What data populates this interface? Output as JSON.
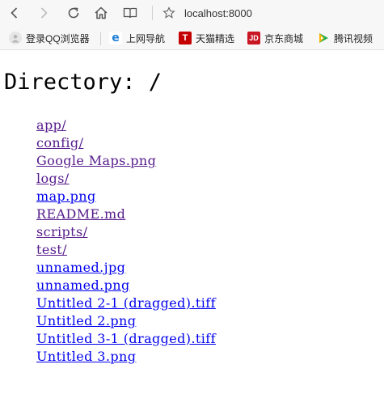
{
  "browser": {
    "address": "localhost:8000",
    "nav_icons": [
      "back-icon",
      "forward-icon",
      "reload-icon",
      "home-icon",
      "reader-icon",
      "bookmark-star-icon"
    ]
  },
  "bookmarks": [
    {
      "label": "登录QQ浏览器",
      "icon": "user-avatar-icon",
      "color": "#bdbdbd"
    },
    {
      "label": "上网导航",
      "icon": "ie-e-icon",
      "color": "#1e7fd6"
    },
    {
      "label": "天猫精选",
      "icon": "tmall-icon",
      "color": "#c40000"
    },
    {
      "label": "京东商城",
      "icon": "jd-icon",
      "color": "#c81623"
    },
    {
      "label": "腾讯视频",
      "icon": "tencent-video-icon",
      "color": "#20b04b"
    }
  ],
  "page": {
    "title": "Directory: /",
    "files": [
      {
        "name": "app/",
        "visited": true
      },
      {
        "name": "config/",
        "visited": true
      },
      {
        "name": "Google Maps.png",
        "visited": true
      },
      {
        "name": "logs/",
        "visited": true
      },
      {
        "name": "map.png",
        "visited": false
      },
      {
        "name": "README.md",
        "visited": true
      },
      {
        "name": "scripts/",
        "visited": true
      },
      {
        "name": "test/",
        "visited": true
      },
      {
        "name": "unnamed.jpg",
        "visited": false
      },
      {
        "name": "unnamed.png",
        "visited": false
      },
      {
        "name": "Untitled 2-1 (dragged).tiff",
        "visited": false
      },
      {
        "name": "Untitled 2.png",
        "visited": false
      },
      {
        "name": "Untitled 3-1 (dragged).tiff",
        "visited": false
      },
      {
        "name": "Untitled 3.png",
        "visited": false
      }
    ]
  },
  "colors": {
    "link": "#0000ee",
    "visited_link": "#551a8b",
    "toolbar_bg": "#f7f7f7"
  }
}
